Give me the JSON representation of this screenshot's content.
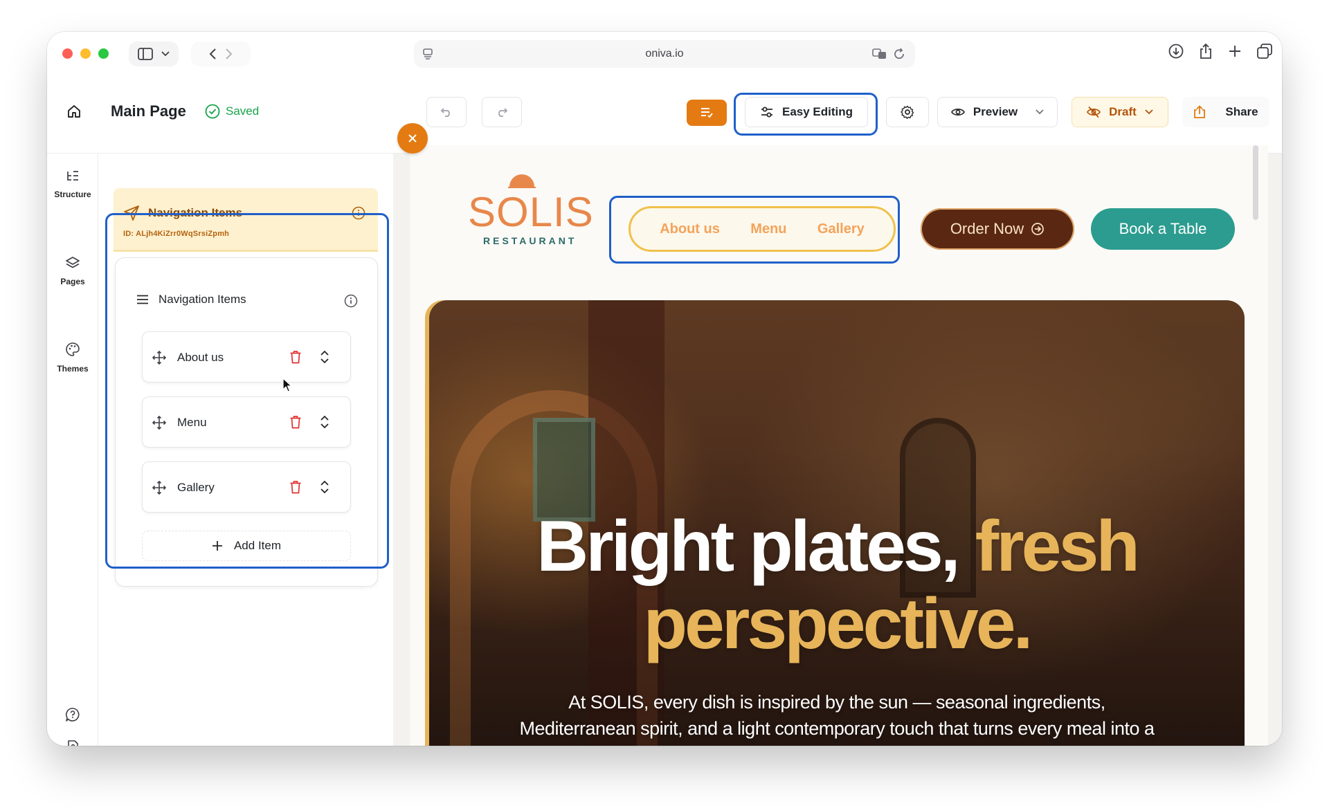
{
  "browser": {
    "url": "oniva.io"
  },
  "toolbar": {
    "page_title": "Main Page",
    "saved_label": "Saved",
    "easy_editing_label": "Easy Editing",
    "preview_label": "Preview",
    "draft_label": "Draft",
    "share_label": "Share"
  },
  "rail": {
    "items": [
      {
        "label": "Structure",
        "icon": "structure-icon"
      },
      {
        "label": "Pages",
        "icon": "layers-icon"
      },
      {
        "label": "Themes",
        "icon": "palette-icon"
      }
    ]
  },
  "panel": {
    "header_title": "Navigation Items",
    "header_id": "ID: ALjh4KiZrr0WqSrsiZpmh",
    "card_title": "Navigation Items",
    "items": [
      {
        "label": "About us"
      },
      {
        "label": "Menu"
      },
      {
        "label": "Gallery"
      }
    ],
    "add_item_label": "Add Item"
  },
  "site": {
    "logo_text": "SOLIS",
    "logo_subtext": "RESTAURANT",
    "nav": [
      "About us",
      "Menu",
      "Gallery"
    ],
    "order_label": "Order Now",
    "book_label": "Book a Table",
    "hero_title_white": "Bright plates,",
    "hero_title_gold_1": "fresh",
    "hero_title_gold_2": "perspective.",
    "hero_subtitle": "At SOLIS, every dish is inspired by the sun — seasonal ingredients, Mediterranean spirit, and a light contemporary touch that turns every meal into a moment to savor."
  },
  "colors": {
    "accent_orange": "#e47b12",
    "highlight_blue": "#1f5fc9",
    "saved_green": "#16a34a",
    "order_brown": "#5a2812",
    "book_teal": "#2b9c8f",
    "hero_gold": "#e7b45a"
  }
}
